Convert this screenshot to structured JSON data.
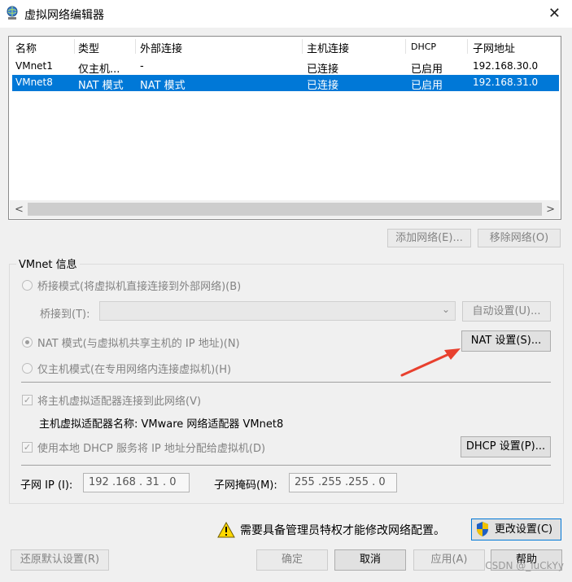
{
  "window": {
    "title": "虚拟网络编辑器",
    "close_glyph": "✕"
  },
  "table": {
    "headers": [
      "名称",
      "类型",
      "外部连接",
      "主机连接",
      "DHCP",
      "子网地址"
    ],
    "rows": [
      [
        "VMnet1",
        "仅主机...",
        "-",
        "已连接",
        "已启用",
        "192.168.30.0"
      ],
      [
        "VMnet8",
        "NAT 模式",
        "NAT 模式",
        "已连接",
        "已启用",
        "192.168.31.0"
      ]
    ],
    "selected_row": 1,
    "scroll_left": "<",
    "scroll_right": ">"
  },
  "list_buttons": {
    "add": "添加网络(E)...",
    "remove": "移除网络(O)"
  },
  "group": {
    "title": "VMnet 信息",
    "bridge_radio": "桥接模式(将虚拟机直接连接到外部网络)(B)",
    "bridge_to_label": "桥接到(T):",
    "bridge_combo_value": "",
    "auto_button": "自动设置(U)...",
    "nat_radio": "NAT 模式(与虚拟机共享主机的 IP 地址)(N)",
    "nat_button": "NAT 设置(S)...",
    "host_only_radio": "仅主机模式(在专用网络内连接虚拟机)(H)",
    "connect_adapter_check": "将主机虚拟适配器连接到此网络(V)",
    "adapter_name_label": "主机虚拟适配器名称: VMware 网络适配器 VMnet8",
    "dhcp_check": "使用本地 DHCP 服务将 IP 地址分配给虚拟机(D)",
    "dhcp_button": "DHCP 设置(P)...",
    "subnet_ip_label": "子网 IP (I):",
    "subnet_ip_value": "192 .168 . 31 . 0",
    "subnet_mask_label": "子网掩码(M):",
    "subnet_mask_value": "255 .255 .255 . 0"
  },
  "footer": {
    "warning_text": "需要具备管理员特权才能修改网络配置。",
    "change_settings": "更改设置(C)",
    "restore_defaults": "还原默认设置(R)",
    "ok": "确定",
    "cancel": "取消",
    "apply": "应用(A)",
    "help": "帮助",
    "watermark": "CSDN @_luCkYy"
  },
  "icons": {
    "app": "network-globe-icon",
    "warning": "warning-triangle-icon",
    "shield": "uac-shield-icon",
    "annotation": "red-arrow-annotation"
  },
  "colors": {
    "selection": "#0078d7",
    "annotation": "#e8402e"
  }
}
